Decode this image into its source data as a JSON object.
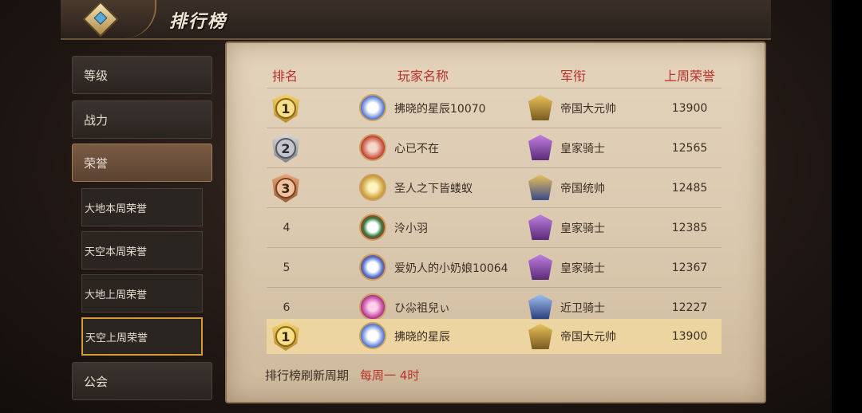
{
  "header": {
    "title": "排行榜",
    "back_icon": "diamond-back-icon"
  },
  "sidebar": {
    "tabs": [
      {
        "label": "等级",
        "active": false
      },
      {
        "label": "战力",
        "active": false
      },
      {
        "label": "荣誉",
        "active": true
      },
      {
        "label": "公会",
        "active": false
      }
    ],
    "subtabs": [
      {
        "label": "大地本周荣誉",
        "selected": false
      },
      {
        "label": "天空本周荣誉",
        "selected": false
      },
      {
        "label": "大地上周荣誉",
        "selected": false
      },
      {
        "label": "天空上周荣誉",
        "selected": true
      }
    ]
  },
  "table": {
    "columns": [
      "排名",
      "玩家名称",
      "军衔",
      "上周荣誉"
    ],
    "rows": [
      {
        "rank": "1",
        "badge": "gold",
        "avatar": "blue-white-flower",
        "name": "拂晓的星辰10070",
        "title": "帝国大元帅",
        "title_icon": "gold-helmet-icon",
        "honor": "13900"
      },
      {
        "rank": "2",
        "badge": "silver",
        "avatar": "red-flower",
        "name": "心已不在",
        "title": "皇家骑士",
        "title_icon": "purple-knight-icon",
        "honor": "12565"
      },
      {
        "rank": "3",
        "badge": "bronze",
        "avatar": "gold-emblem",
        "name": "圣人之下皆蝼蚁",
        "title": "帝国统帅",
        "title_icon": "gold-blue-helmet-icon",
        "honor": "12485"
      },
      {
        "rank": "4",
        "badge": "",
        "avatar": "wreath-paw",
        "name": "泠小羽",
        "title": "皇家骑士",
        "title_icon": "purple-knight-icon",
        "honor": "12385"
      },
      {
        "rank": "5",
        "badge": "",
        "avatar": "blue-white-flower",
        "name": "爱奶人的小奶娘10064",
        "title": "皇家骑士",
        "title_icon": "purple-knight-icon",
        "honor": "12367"
      },
      {
        "rank": "6",
        "badge": "",
        "avatar": "pink-orb",
        "name": "ひ尛祖兒ぃ",
        "title": "近卫骑士",
        "title_icon": "blue-knight-icon",
        "honor": "12227"
      }
    ],
    "my_row": {
      "rank": "1",
      "badge": "gold",
      "avatar": "blue-white-flower",
      "name": "拂晓的星辰",
      "title": "帝国大元帅",
      "title_icon": "gold-helmet-icon",
      "honor": "13900"
    }
  },
  "footer": {
    "label": "排行榜刷新周期",
    "value": "每周一 4时"
  },
  "colors": {
    "header_text": "#b8322a",
    "panel": "#e4d4bd",
    "highlight_row": "#f6dca0",
    "selected_border": "#d39a3e"
  }
}
